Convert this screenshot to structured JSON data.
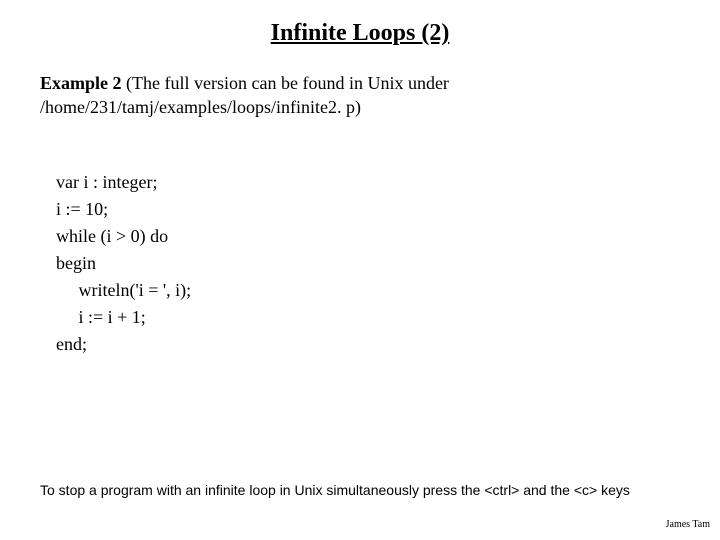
{
  "title": "Infinite Loops (2)",
  "example": {
    "label": "Example 2",
    "intro_rest": " (The full version can be found in Unix under /home/231/tamj/examples/loops/infinite2. p)"
  },
  "code": {
    "line1": "var i : integer;",
    "line2": "i := 10;",
    "line3": "while (i > 0) do",
    "line4": "begin",
    "line5": "     writeln('i = ', i);",
    "line6": "     i := i + 1;",
    "line7": "end;"
  },
  "footer_note": "To stop a program with an infinite loop in Unix simultaneously press the  <ctrl> and the <c> keys",
  "author": "James Tam"
}
